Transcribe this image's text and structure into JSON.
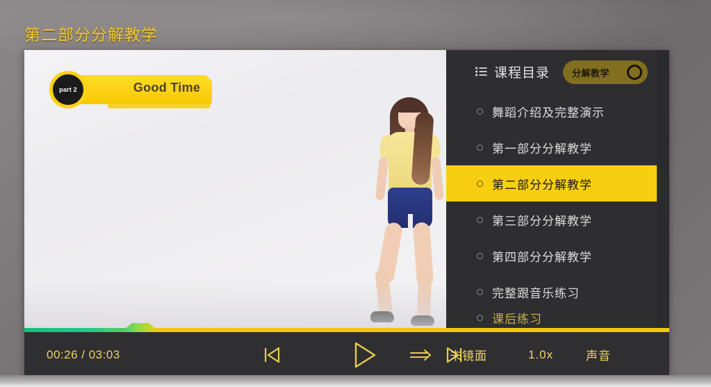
{
  "page": {
    "title": "第二部分分解教学",
    "background_color": "#6e696b",
    "accent_color": "#f7cf10"
  },
  "video": {
    "overlay_badge": {
      "circle_label": "part 2",
      "banner_label": "Good Time",
      "banner_color": "#fcd116",
      "circle_color": "#1b1b1b"
    }
  },
  "sidebar": {
    "icon": "list-icon",
    "title": "课程目录",
    "mode_badge": {
      "label": "分解教学",
      "knob_icon": "circle-toggle-icon"
    },
    "items": [
      {
        "label": "舞蹈介绍及完整演示",
        "active": false
      },
      {
        "label": "第一部分分解教学",
        "active": false
      },
      {
        "label": "第二部分分解教学",
        "active": true
      },
      {
        "label": "第三部分分解教学",
        "active": false
      },
      {
        "label": "第四部分分解教学",
        "active": false
      },
      {
        "label": "完整跟音乐练习",
        "active": false
      }
    ],
    "clipped_item": {
      "label": "课后练习"
    },
    "scrollbar": {
      "up_icon": "chevron-up-icon",
      "down_icon": "chevron-down-icon"
    }
  },
  "progress": {
    "percent": 16.7,
    "fill_color": "#1ec98a",
    "track_color": "#f0c80f"
  },
  "controls": {
    "time_current": "00:26",
    "time_total": "03:03",
    "time_display": "00:26 / 03:03",
    "prev_icon": "previous-track-icon",
    "play_icon": "play-icon",
    "forward_icon": "arrow-right-icon",
    "next_icon": "next-track-icon",
    "mirror_label": "未镜面",
    "speed_label": "1.0x",
    "sound_label": "声音"
  }
}
